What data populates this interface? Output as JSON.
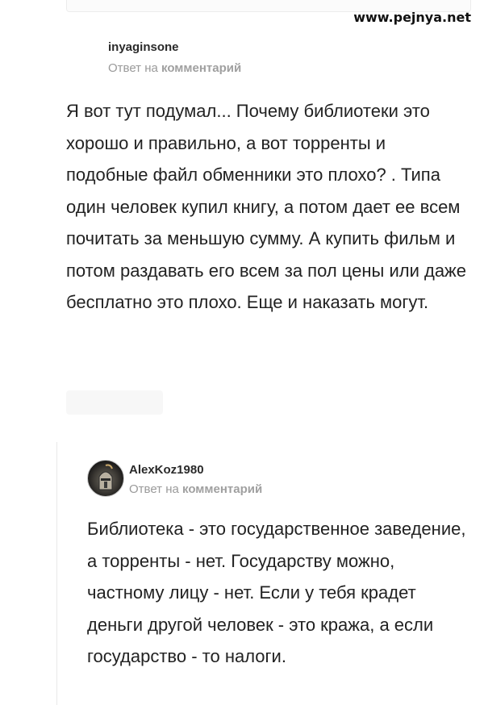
{
  "watermark": "www.pejnya.net",
  "comments": [
    {
      "username": "inyaginsone",
      "reply_prefix": "Ответ на",
      "reply_link": "комментарий",
      "text": "Я вот тут подумал... Почему библиотеки это хорошо и правильно, а вот торренты и подобные файл обменники это плохо? . Типа один человек купил книгу, а потом дает ее всем почитать за меньшую сумму. А купить фильм и потом раздавать его всем за пол цены или даже бесплатно это плохо. Еще и наказать могут."
    },
    {
      "username": "AlexKoz1980",
      "reply_prefix": "Ответ на",
      "reply_link": "комментарий",
      "text": "Библиотека - это государственное заведение, а торренты - нет. Государству можно, частному лицу - нет. Если у тебя крадет деньги другой человек - это кража, а если государство - то налоги."
    }
  ]
}
